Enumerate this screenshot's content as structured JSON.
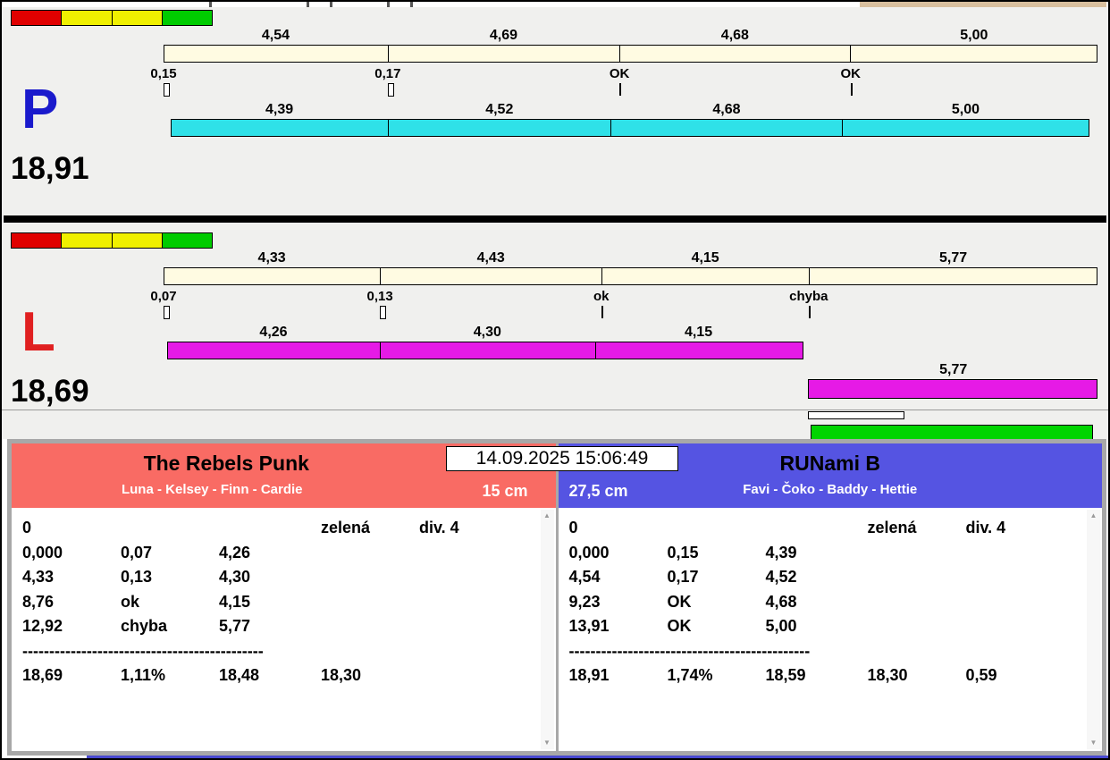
{
  "colors": {
    "section_bg": "#f0f0ee",
    "top_bar_fill": "#fffbe2",
    "red_header": "#f96b64",
    "blue_header": "#5554e2",
    "bottom_strip": "#4a4ad0",
    "top_corner": "#d8bf9e",
    "green_bar": "#00d400",
    "chip": [
      "#e00000",
      "#f0f000",
      "#f0f000",
      "#00cc00"
    ]
  },
  "icons": {
    "scroll_up": "▲",
    "scroll_down": "▼"
  },
  "datetime": "14.09.2025 15:06:49",
  "lanes": [
    {
      "id": "p",
      "letter": "P",
      "letter_color": "#1a1acc",
      "total_label": "18,91",
      "total_seconds": 18.91,
      "bar_fill": "#2fe1e8",
      "top_segments": [
        {
          "t": 4.54,
          "label": "4,54"
        },
        {
          "t": 4.69,
          "label": "4,69"
        },
        {
          "t": 4.68,
          "label": "4,68"
        },
        {
          "t": 5.0,
          "label": "5,00"
        }
      ],
      "marks": [
        {
          "label": "0,15",
          "box": true
        },
        {
          "label": "0,17",
          "box": true
        },
        {
          "label": "OK",
          "box": false
        },
        {
          "label": "OK",
          "box": false
        }
      ],
      "bottom_start": 0.15,
      "bottom_segments": [
        {
          "t": 4.39,
          "label": "4,39"
        },
        {
          "t": 4.52,
          "label": "4,52"
        },
        {
          "t": 4.68,
          "label": "4,68"
        },
        {
          "t": 5.0,
          "label": "5,00"
        }
      ],
      "overflow": null
    },
    {
      "id": "l",
      "letter": "L",
      "letter_color": "#e02020",
      "total_label": "18,69",
      "total_seconds": 18.69,
      "bar_fill": "#e61ae6",
      "top_segments": [
        {
          "t": 4.33,
          "label": "4,33"
        },
        {
          "t": 4.43,
          "label": "4,43"
        },
        {
          "t": 4.15,
          "label": "4,15"
        },
        {
          "t": 5.77,
          "label": "5,77"
        }
      ],
      "marks": [
        {
          "label": "0,07",
          "box": true
        },
        {
          "label": "0,13",
          "box": true
        },
        {
          "label": "ok",
          "box": false
        },
        {
          "label": "chyba",
          "box": false
        }
      ],
      "bottom_start": 0.07,
      "bottom_segments": [
        {
          "t": 4.26,
          "label": "4,26"
        },
        {
          "t": 4.3,
          "label": "4,30"
        },
        {
          "t": 4.15,
          "label": "4,15"
        }
      ],
      "overflow": {
        "start": 12.92,
        "t": 5.77,
        "label": "5,77"
      }
    }
  ],
  "results": {
    "left": {
      "team": "The Rebels Punk",
      "members": "Luna - Kelsey - Finn - Cardie",
      "height": "15 cm",
      "rows": [
        {
          "cells": [
            "0",
            "",
            "",
            "zelená",
            "div. 4"
          ]
        },
        {
          "cells": [
            "0,000",
            "0,07",
            "4,26",
            "",
            ""
          ]
        },
        {
          "cells": [
            "4,33",
            "0,13",
            "4,30",
            "",
            ""
          ]
        },
        {
          "cells": [
            "8,76",
            "ok",
            "4,15",
            "",
            ""
          ]
        },
        {
          "cells": [
            "12,92",
            "chyba",
            "5,77",
            "",
            ""
          ]
        },
        {
          "separator": "---------------------------------------------"
        },
        {
          "cells": [
            "18,69",
            "1,11%",
            "18,48",
            "18,30",
            ""
          ]
        }
      ]
    },
    "right": {
      "team": "RUNami B",
      "members": "Favi - Čoko - Baddy - Hettie",
      "height": "27,5 cm",
      "rows": [
        {
          "cells": [
            "0",
            "",
            "",
            "zelená",
            "div. 4"
          ]
        },
        {
          "cells": [
            "0,000",
            "0,15",
            "4,39",
            "",
            ""
          ]
        },
        {
          "cells": [
            "4,54",
            "0,17",
            "4,52",
            "",
            ""
          ]
        },
        {
          "cells": [
            "9,23",
            "OK",
            "4,68",
            "",
            ""
          ]
        },
        {
          "cells": [
            "13,91",
            "OK",
            "5,00",
            "",
            ""
          ]
        },
        {
          "separator": "---------------------------------------------"
        },
        {
          "cells": [
            "18,91",
            "1,74%",
            "18,59",
            "18,30",
            "0,59"
          ]
        }
      ]
    }
  }
}
